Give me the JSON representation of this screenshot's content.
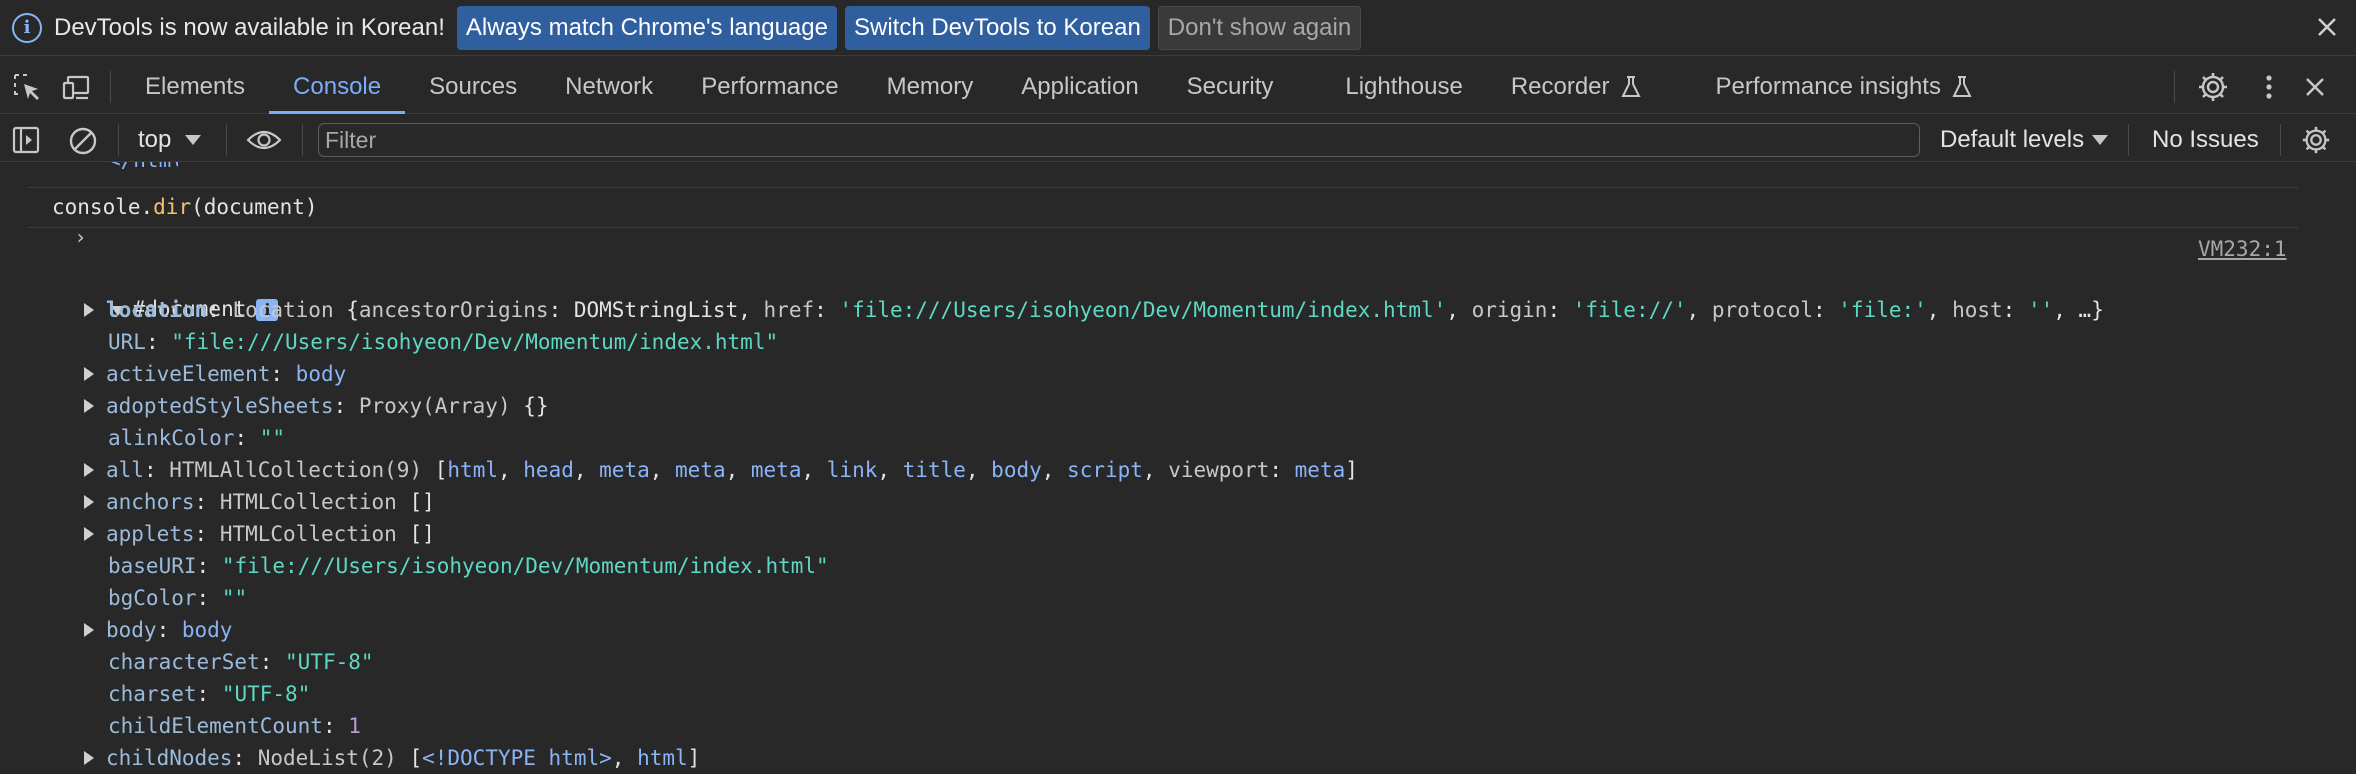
{
  "infobar": {
    "message": "DevTools is now available in Korean!",
    "btn_match": "Always match Chrome's language",
    "btn_switch": "Switch DevTools to Korean",
    "btn_dismiss": "Don't show again"
  },
  "tabs": [
    "Elements",
    "Console",
    "Sources",
    "Network",
    "Performance",
    "Memory",
    "Application",
    "Security",
    "Lighthouse",
    "Recorder",
    "Performance insights"
  ],
  "toolbar": {
    "context": "top",
    "filter_placeholder": "Filter",
    "levels": "Default levels",
    "issues": "No Issues"
  },
  "console": {
    "prompt_cmd_prefix": "console.",
    "prompt_cmd_fn": "dir",
    "prompt_cmd_suffix": "(document)",
    "source_link": "VM232:1",
    "root_label": "#document",
    "location": {
      "key": "location",
      "cls": "Location",
      "ancestorOrigins_key": "ancestorOrigins",
      "ancestorOrigins_val": "DOMStringList",
      "href_key": "href",
      "href_val": "'file:///Users/isohyeon/Dev/Momentum/index.html'",
      "origin_key": "origin",
      "origin_val": "'file://'",
      "protocol_key": "protocol",
      "protocol_val": "'file:'",
      "host_key": "host",
      "host_val": "''"
    },
    "url": {
      "key": "URL",
      "val": "\"file:///Users/isohyeon/Dev/Momentum/index.html\""
    },
    "activeElement": {
      "key": "activeElement",
      "val": "body"
    },
    "adoptedStyleSheets": {
      "key": "adoptedStyleSheets",
      "val": "Proxy(Array)"
    },
    "alinkColor": {
      "key": "alinkColor",
      "val": "\"\""
    },
    "all": {
      "key": "all",
      "cls": "HTMLAllCollection(9)",
      "items": [
        "html",
        "head",
        "meta",
        "meta",
        "meta",
        "link",
        "title",
        "body",
        "script"
      ],
      "named_key": "viewport",
      "named_val": "meta"
    },
    "anchors": {
      "key": "anchors",
      "cls": "HTMLCollection"
    },
    "applets": {
      "key": "applets",
      "cls": "HTMLCollection"
    },
    "baseURI": {
      "key": "baseURI",
      "val": "\"file:///Users/isohyeon/Dev/Momentum/index.html\""
    },
    "bgColor": {
      "key": "bgColor",
      "val": "\"\""
    },
    "body": {
      "key": "body",
      "val": "body"
    },
    "characterSet": {
      "key": "characterSet",
      "val": "\"UTF-8\""
    },
    "charset": {
      "key": "charset",
      "val": "\"UTF-8\""
    },
    "childElementCount": {
      "key": "childElementCount",
      "val": "1"
    },
    "childNodes": {
      "key": "childNodes",
      "cls": "NodeList(2)",
      "doctype": "<!DOCTYPE html>",
      "item": "html"
    }
  },
  "colors": {
    "accent": "#7cacf8",
    "background": "#282828",
    "string": "#5ed8c4",
    "key": "#9bbbdc"
  }
}
